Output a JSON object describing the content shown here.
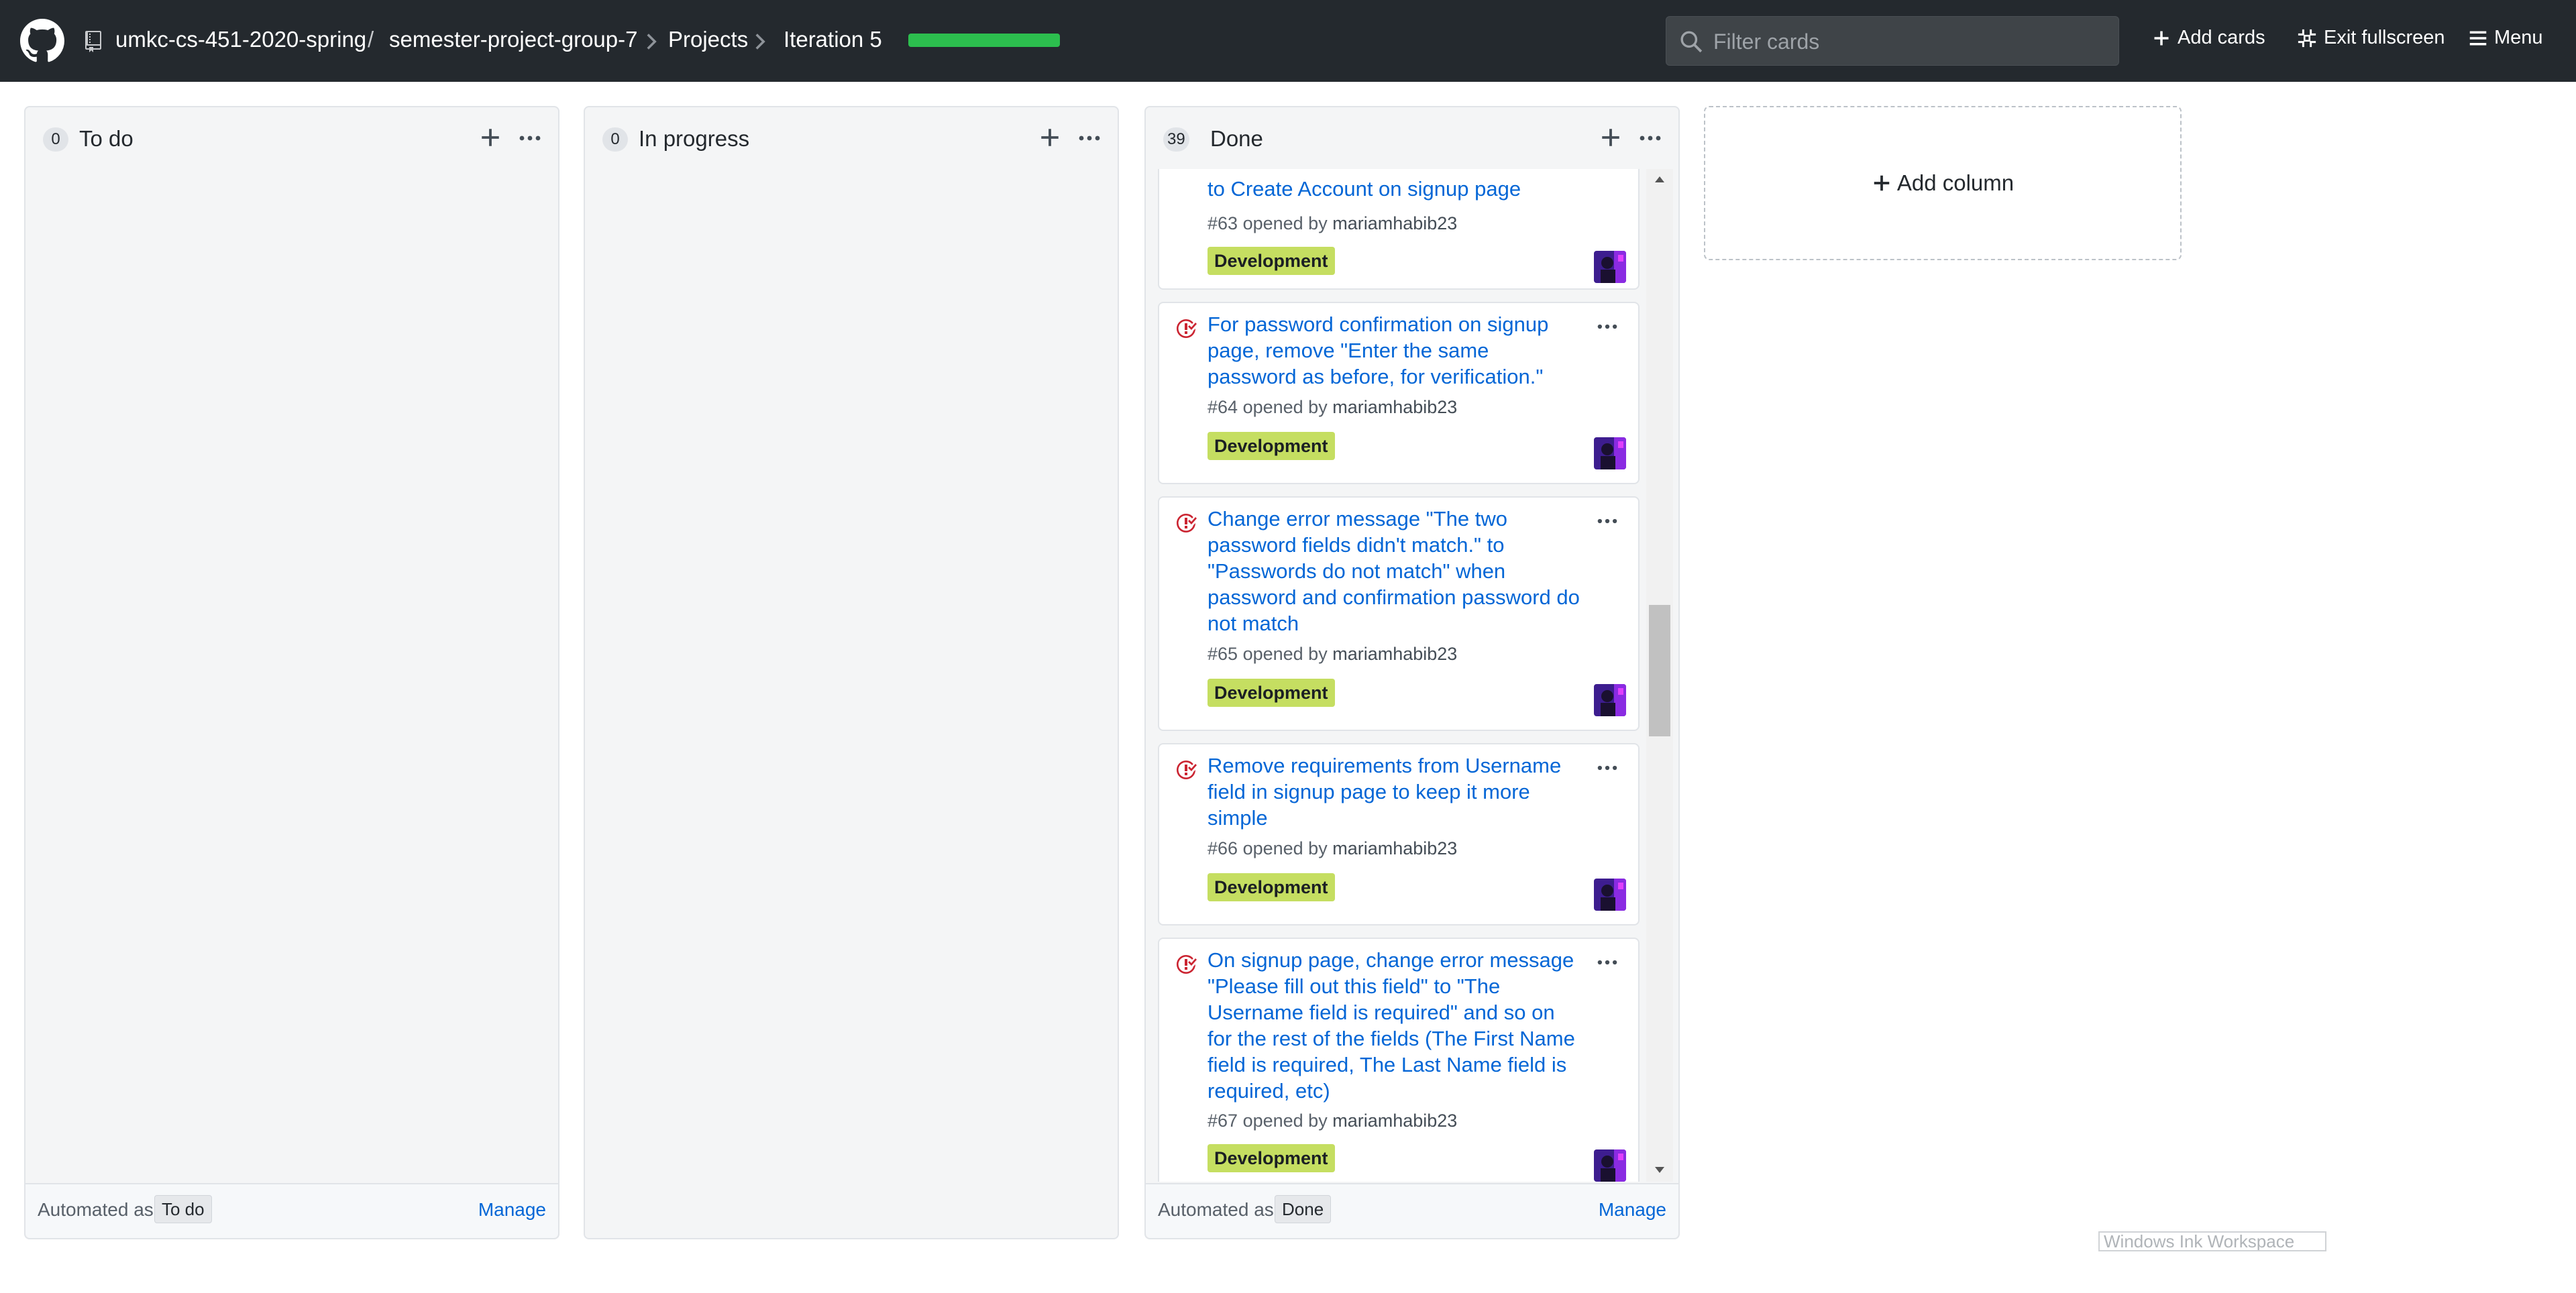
{
  "header": {
    "org": "umkc-cs-451-2020-spring",
    "separator": "/",
    "repo": "semester-project-group-7",
    "projects": "Projects",
    "project_name": "Iteration 5",
    "progress": 1.0,
    "filter_placeholder": "Filter cards",
    "add_cards": "Add cards",
    "exit_fullscreen": "Exit fullscreen",
    "menu": "Menu"
  },
  "columns": [
    {
      "count": "0",
      "title": "To do",
      "footer_prefix": "Automated as",
      "footer_badge": "To do",
      "manage": "Manage"
    },
    {
      "count": "0",
      "title": "In progress"
    },
    {
      "count": "39",
      "title": "Done",
      "footer_prefix": "Automated as",
      "footer_badge": "Done",
      "manage": "Manage",
      "cards": [
        {
          "title": "to Create Account on signup page",
          "number": "#63",
          "opened_by": "opened by",
          "author": "mariamhabib23",
          "label": "Development"
        },
        {
          "title": "For password confirmation on signup page, remove \"Enter the same password as before, for verification.\"",
          "number": "#64",
          "opened_by": "opened by",
          "author": "mariamhabib23",
          "label": "Development"
        },
        {
          "title": "Change error message \"The two password fields didn't match.\" to \"Passwords do not match\" when password and confirmation password do not match",
          "number": "#65",
          "opened_by": "opened by",
          "author": "mariamhabib23",
          "label": "Development"
        },
        {
          "title": "Remove requirements from Username field in signup page to keep it more simple",
          "number": "#66",
          "opened_by": "opened by",
          "author": "mariamhabib23",
          "label": "Development"
        },
        {
          "title": "On signup page, change error message \"Please fill out this field\" to \"The Username field is required\" and so on for the rest of the fields (The First Name field is required, The Last Name field is required, etc)",
          "number": "#67",
          "opened_by": "opened by",
          "author": "mariamhabib23",
          "label": "Development"
        }
      ]
    }
  ],
  "add_column": "Add column",
  "ink_workspace": "Windows Ink Workspace",
  "colors": {
    "header_bg": "#24292e",
    "progress": "#2cbe4e",
    "link": "#0366d6",
    "label_development": "#c5de61",
    "closed_issue": "#cb2431"
  },
  "icons": [
    "github-logo-icon",
    "repo-icon",
    "chevron-right-icon",
    "search-icon",
    "plus-icon",
    "fullscreen-exit-icon",
    "hamburger-icon",
    "kebab-icon",
    "issue-closed-icon"
  ]
}
